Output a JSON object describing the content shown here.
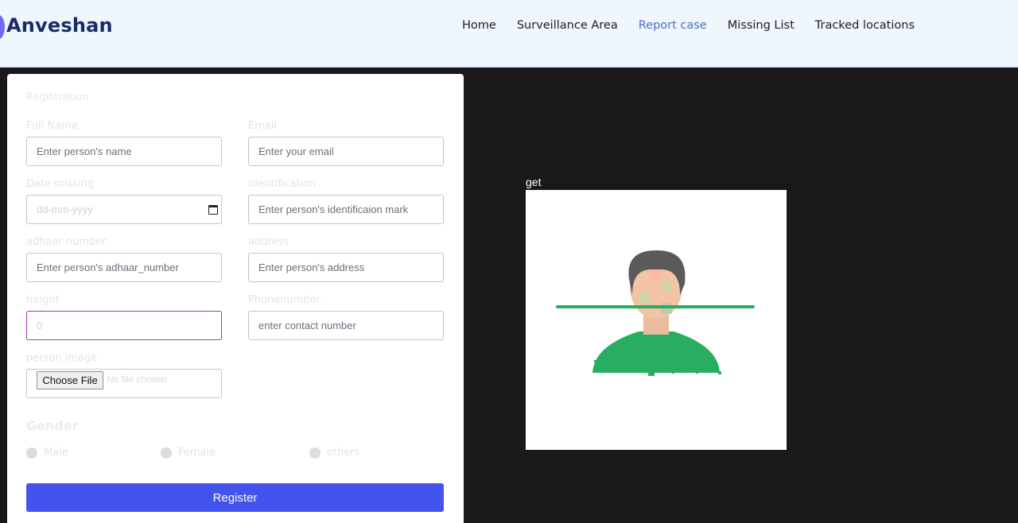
{
  "brand": {
    "name": "Anveshan"
  },
  "nav": {
    "items": [
      {
        "label": "Home"
      },
      {
        "label": "Surveillance Area"
      },
      {
        "label": "Report case"
      },
      {
        "label": "Missing List"
      },
      {
        "label": "Tracked locations"
      }
    ],
    "active": "Report case"
  },
  "form": {
    "title": "Registration",
    "full_name": {
      "label": "Full Name",
      "placeholder": "Enter person's name"
    },
    "email": {
      "label": "Email",
      "placeholder": "Enter your email"
    },
    "date_missing": {
      "label": "Date missing",
      "placeholder": "dd-mm-yyyy"
    },
    "identification": {
      "label": "Identification",
      "placeholder": "Enter person's identificaion mark"
    },
    "adhaar": {
      "label": "adhaar number",
      "placeholder": "Enter person's adhaar_number"
    },
    "address": {
      "label": "address",
      "placeholder": "Enter person's address"
    },
    "height": {
      "label": "height",
      "value": "0"
    },
    "phone": {
      "label": "Phonenumber",
      "placeholder": "enter contact number"
    },
    "image": {
      "label": "person image",
      "button": "Choose File",
      "status": "No file chosen"
    },
    "gender": {
      "title": "Gender",
      "options": [
        "Male",
        "Female",
        "others"
      ]
    },
    "submit_label": "Register"
  },
  "preview": {
    "caption": "get",
    "image_icon": "face-scan-icon",
    "colors": {
      "accent": "#27ae60",
      "hair": "#5a5a5a",
      "skin": "#f2c3a5"
    }
  }
}
